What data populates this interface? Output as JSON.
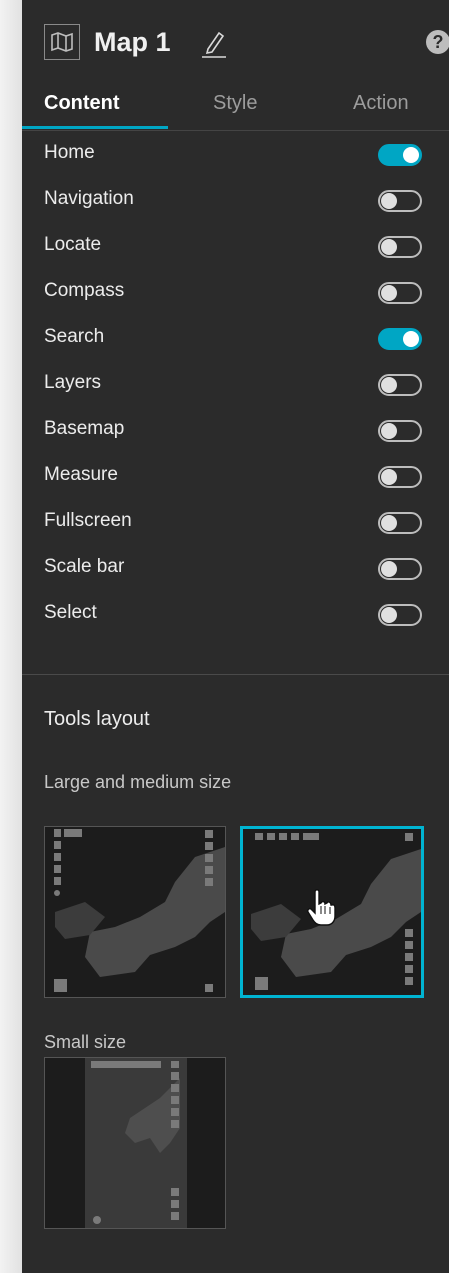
{
  "header": {
    "title": "Map 1",
    "icon": "map-icon",
    "edit_icon": "pencil-icon",
    "help_icon": "help-icon"
  },
  "tabs": [
    {
      "label": "Content",
      "active": true
    },
    {
      "label": "Style",
      "active": false
    },
    {
      "label": "Action",
      "active": false
    }
  ],
  "tools": [
    {
      "label": "Home",
      "on": true
    },
    {
      "label": "Navigation",
      "on": false
    },
    {
      "label": "Locate",
      "on": false
    },
    {
      "label": "Compass",
      "on": false
    },
    {
      "label": "Search",
      "on": true
    },
    {
      "label": "Layers",
      "on": false
    },
    {
      "label": "Basemap",
      "on": false
    },
    {
      "label": "Measure",
      "on": false
    },
    {
      "label": "Fullscreen",
      "on": false
    },
    {
      "label": "Scale bar",
      "on": false
    },
    {
      "label": "Select",
      "on": false
    }
  ],
  "tools_layout": {
    "title": "Tools layout",
    "large_medium_label": "Large and medium size",
    "small_label": "Small size",
    "selected_large_layout": 2
  },
  "colors": {
    "accent": "#00a6c4",
    "panel_bg": "#2b2b2b"
  }
}
